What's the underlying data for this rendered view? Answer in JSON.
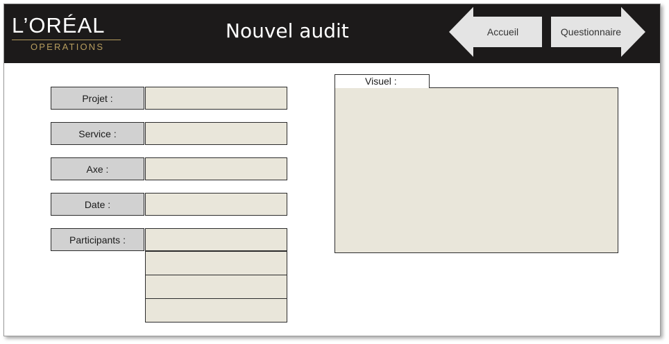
{
  "header": {
    "logo_main": "L’ORÉAL",
    "logo_sub": "OPERATIONS",
    "title": "Nouvel audit",
    "back_button": "Accueil",
    "next_button": "Questionnaire"
  },
  "colors": {
    "header_bg": "#1c1a1a",
    "logo_gold": "#b79d5e",
    "label_bg": "#d1d1d1",
    "input_bg": "#e9e6da",
    "arrow_fill": "#e4e4e4"
  },
  "form": {
    "fields": [
      {
        "label": "Projet :",
        "value": ""
      },
      {
        "label": "Service :",
        "value": ""
      },
      {
        "label": "Axe :",
        "value": ""
      },
      {
        "label": "Date :",
        "value": ""
      },
      {
        "label": "Participants :",
        "value": ""
      }
    ],
    "participants_extra": [
      "",
      "",
      ""
    ]
  },
  "visual": {
    "label": "Visuel :"
  }
}
